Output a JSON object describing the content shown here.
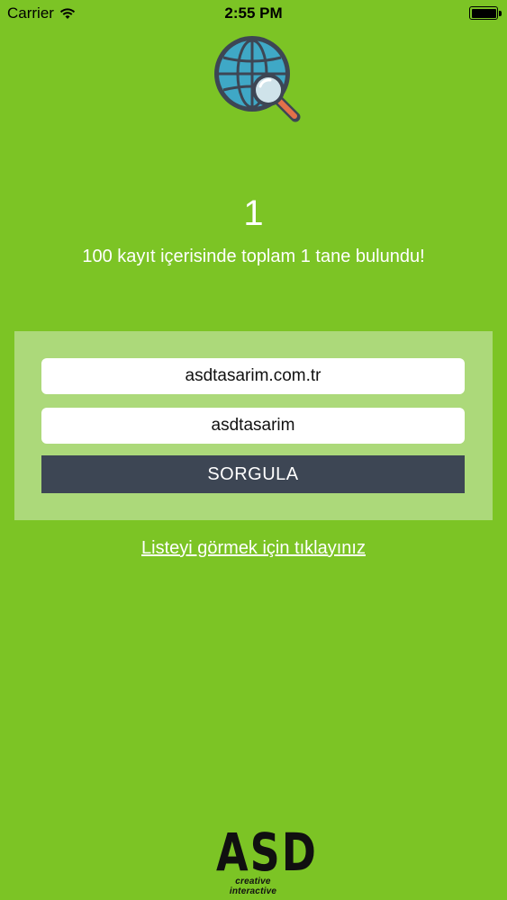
{
  "status_bar": {
    "carrier": "Carrier",
    "time": "2:55 PM"
  },
  "app_icon": "globe-search-icon",
  "result": {
    "count": "1",
    "summary": "100 kayıt içerisinde toplam 1 tane bulundu!"
  },
  "form": {
    "domain_value": "asdtasarim.com.tr",
    "name_value": "asdtasarim",
    "submit_label": "SORGULA"
  },
  "list_link": "Listeyi görmek için tıklayınız",
  "footer": {
    "logo_text": "ASD",
    "tagline": "creative interactive"
  },
  "colors": {
    "background": "#7cc425",
    "panel": "#acd97a",
    "button": "#3d4654"
  }
}
